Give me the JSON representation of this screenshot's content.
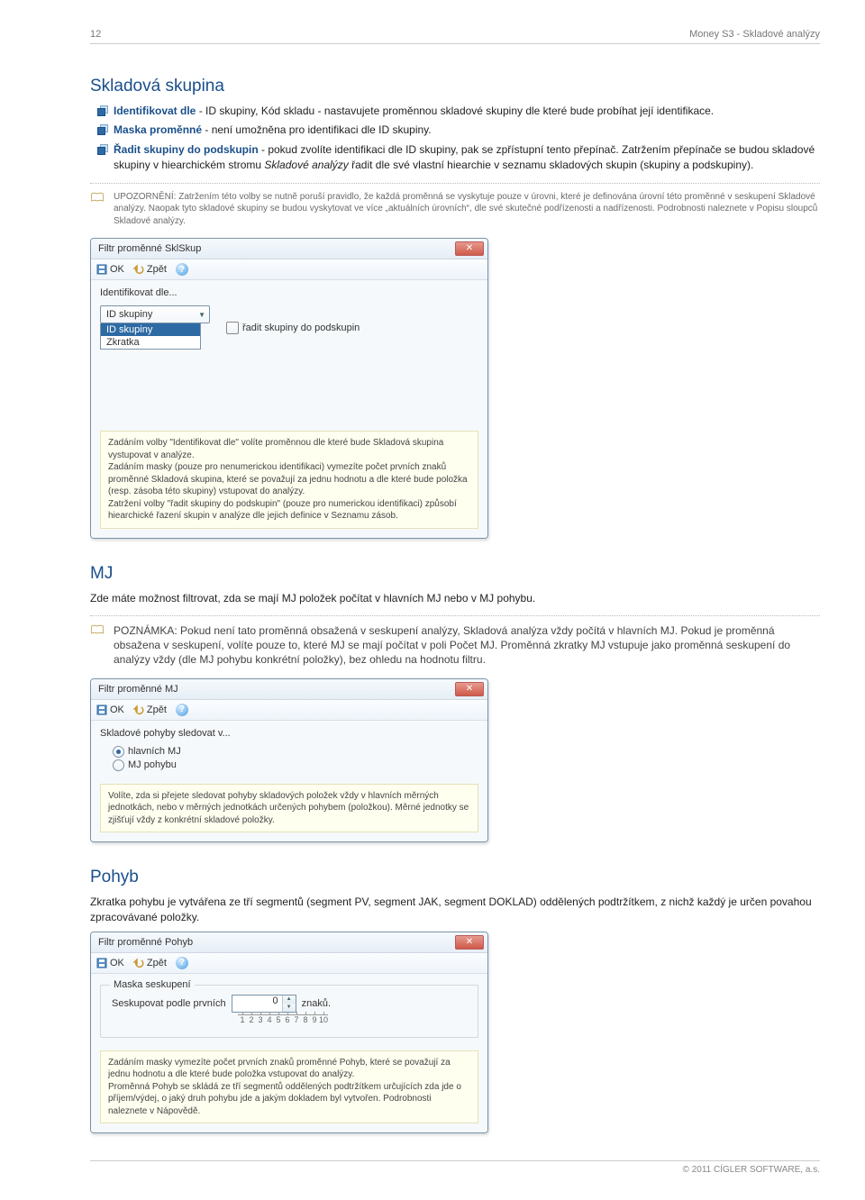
{
  "header": {
    "page_number": "12",
    "doc_title": "Money S3 - Skladové analýzy"
  },
  "section1": {
    "title": "Skladová skupina",
    "bullets": [
      {
        "bold": "Identifikovat dle",
        "rest": " - ID skupiny, Kód skladu - nastavujete proměnnou skladové skupiny dle které bude probíhat její identifikace."
      },
      {
        "bold": "Maska proměnné",
        "rest": " - není umožněna pro identifikaci dle ID skupiny."
      },
      {
        "bold": "Řadit skupiny do podskupin",
        "rest": " - pokud zvolíte identifikaci dle ID skupiny, pak se zpřístupní tento přepínač. Zatržením přepínače se budou skladové skupiny v hiearchickém stromu Skladové analýzy řadit dle své vlastní hiearchie v seznamu skladových skupin (skupiny a podskupiny)."
      }
    ],
    "note": "UPOZORNĚNÍ: Zatržením této volby se nutně poruší pravidlo, že každá proměnná se vyskytuje pouze v úrovni, které je definována úrovní této proměnné v seskupení Skladové analýzy. Naopak tyto skladové skupiny se budou vyskytovat ve více „aktuálních úrovních“, dle své skutečné podřízenosti a nadřízenosti. Podrobnosti naleznete v Popisu sloupců Skladové analýzy."
  },
  "dialog1": {
    "title": "Filtr proměnné SklSkup",
    "toolbar": {
      "ok": "OK",
      "back": "Zpět"
    },
    "label": "Identifikovat dle...",
    "combo_value": "ID skupiny",
    "combo_options": [
      "ID skupiny",
      "Zkratka"
    ],
    "checkbox": "řadit skupiny do podskupin",
    "hint": "Zadáním volby \"Identifikovat dle\" volíte proměnnou dle které bude Skladová skupina vystupovat v analýze.\nZadáním masky (pouze pro nenumerickou identifikaci) vymezíte počet prvních znaků proměnné Skladová skupina, které se považují za jednu hodnotu a dle které bude položka (resp. zásoba této skupiny) vstupovat do analýzy.\nZatržení volby \"řadit skupiny do podskupin\" (pouze pro numerickou identifikaci) způsobí hiearchické řazení skupin v analýze dle jejich definice v Seznamu zásob."
  },
  "section2": {
    "title": "MJ",
    "text": "Zde máte možnost filtrovat, zda se mají MJ položek počítat v hlavních MJ nebo v MJ pohybu.",
    "note": "POZNÁMKA: Pokud není tato proměnná obsažená v seskupení analýzy, Skladová analýza vždy počítá v hlavních MJ. Pokud je proměnná obsažena v seskupení, volíte pouze to, které MJ se mají počítat v poli Počet MJ. Proměnná zkratky MJ vstupuje jako proměnná seskupení do analýzy vždy (dle MJ pohybu konkrétní položky), bez ohledu na hodnotu filtru."
  },
  "dialog2": {
    "title": "Filtr proměnné MJ",
    "toolbar": {
      "ok": "OK",
      "back": "Zpět"
    },
    "label": "Skladové pohyby sledovat v...",
    "radios": [
      "hlavních MJ",
      "MJ pohybu"
    ],
    "hint": "Volíte, zda si přejete sledovat pohyby skladových položek vždy v hlavních měrných jednotkách, nebo v měrných jednotkách určených pohybem (položkou). Měrné jednotky se zjišťují vždy z konkrétní skladové položky."
  },
  "section3": {
    "title": "Pohyb",
    "text": "Zkratka pohybu je vytvářena ze tří segmentů (segment PV, segment JAK, segment DOKLAD) oddělených podtržítkem, z nichž každý je určen povahou zpracovávané položky."
  },
  "dialog3": {
    "title": "Filtr proměnné Pohyb",
    "toolbar": {
      "ok": "OK",
      "back": "Zpět"
    },
    "legend": "Maska seskupení",
    "mask_before": "Seskupovat podle prvních",
    "mask_value": "0",
    "mask_after": "znaků.",
    "scale": [
      "1",
      "2",
      "3",
      "4",
      "5",
      "6",
      "7",
      "8",
      "9",
      "10"
    ],
    "hint": "Zadáním masky vymezíte počet prvních znaků proměnné Pohyb, které se považují za jednu hodnotu a dle které bude položka vstupovat do analýzy.\nProměnná Pohyb se skládá ze tří segmentů oddělených podtržítkem určujících zda jde o příjem/výdej, o jaký druh pohybu jde a jakým dokladem byl vytvořen. Podrobnosti naleznete v Nápovědě."
  },
  "footer": "© 2011 CÍGLER SOFTWARE, a.s."
}
